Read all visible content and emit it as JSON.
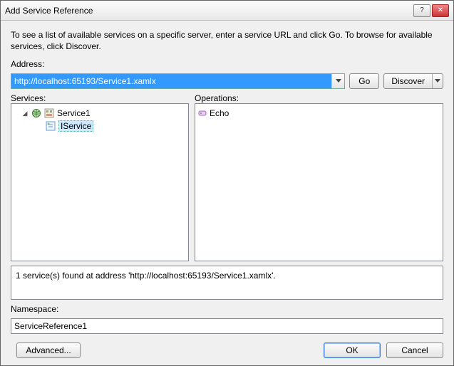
{
  "window": {
    "title": "Add Service Reference"
  },
  "instruction": "To see a list of available services on a specific server, enter a service URL and click Go. To browse for available services, click Discover.",
  "address": {
    "label": "Address:",
    "value": "http://localhost:65193/Service1.xamlx",
    "go_label": "Go",
    "discover_label": "Discover"
  },
  "services": {
    "label": "Services:",
    "root": "Service1",
    "contract": "IService"
  },
  "operations": {
    "label": "Operations:",
    "items": [
      "Echo"
    ]
  },
  "status": "1 service(s) found at address 'http://localhost:65193/Service1.xamlx'.",
  "namespace": {
    "label": "Namespace:",
    "value": "ServiceReference1"
  },
  "buttons": {
    "advanced": "Advanced...",
    "ok": "OK",
    "cancel": "Cancel"
  }
}
